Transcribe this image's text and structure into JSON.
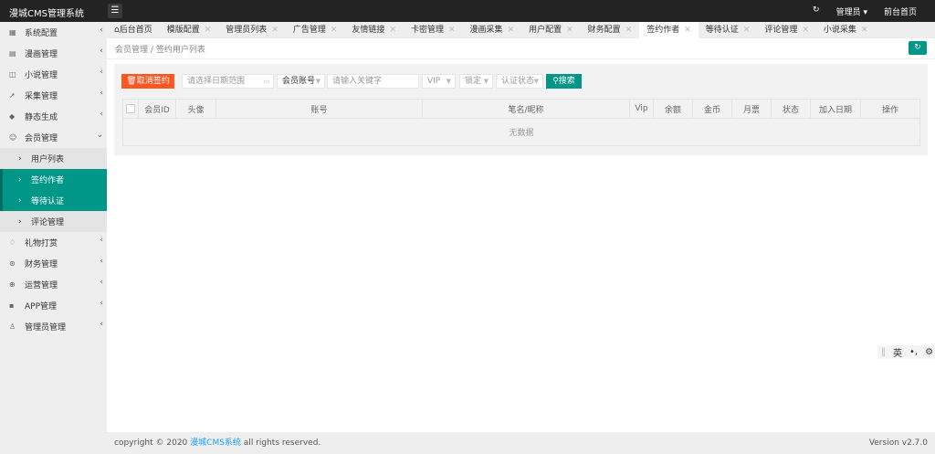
{
  "header": {
    "title": "漫城CMS管理系统",
    "menu_icon": "menu-icon",
    "refresh_icon": "refresh-icon",
    "user": "管理员",
    "home": "前台首页"
  },
  "sidebar": {
    "items": [
      {
        "icon": "sitemap-icon",
        "label": "系统配置"
      },
      {
        "icon": "comic-icon",
        "label": "漫画管理"
      },
      {
        "icon": "book-icon",
        "label": "小说管理"
      },
      {
        "icon": "paper-plane-icon",
        "label": "采集管理"
      },
      {
        "icon": "graduation-icon",
        "label": "静态生成"
      },
      {
        "icon": "user-icon",
        "label": "会员管理",
        "expanded": true,
        "children": [
          {
            "label": "用户列表"
          },
          {
            "label": "签约作者",
            "active": true
          },
          {
            "label": "等待认证",
            "active": true
          },
          {
            "label": "评论管理"
          }
        ]
      },
      {
        "icon": "gift-icon",
        "label": "礼物打赏"
      },
      {
        "icon": "finance-icon",
        "label": "财务管理"
      },
      {
        "icon": "globe-icon",
        "label": "运营管理"
      },
      {
        "icon": "windows-icon",
        "label": "APP管理"
      },
      {
        "icon": "admin-icon",
        "label": "管理员管理"
      }
    ]
  },
  "tabs": [
    {
      "label": "后台首页"
    },
    {
      "label": "模版配置"
    },
    {
      "label": "管理员列表"
    },
    {
      "label": "广告管理"
    },
    {
      "label": "友情链接"
    },
    {
      "label": "卡密管理"
    },
    {
      "label": "漫画采集"
    },
    {
      "label": "用户配置"
    },
    {
      "label": "财务配置"
    },
    {
      "label": "签约作者",
      "active": true
    },
    {
      "label": "等待认证"
    },
    {
      "label": "评论管理"
    },
    {
      "label": "小说采集"
    }
  ],
  "breadcrumb": {
    "parent": "会员管理",
    "sep": "/",
    "current": "签约用户列表"
  },
  "toolbar": {
    "cancel_sign": "取消签约",
    "date_placeholder": "请选择日期范围",
    "field_select": "会员账号",
    "keyword_placeholder": "请输入关键字",
    "vip_select": "VIP",
    "lock_select": "锁定",
    "auth_select": "认证状态",
    "search": "搜索"
  },
  "table": {
    "columns": [
      "会员ID",
      "头像",
      "账号",
      "笔名/昵称",
      "Vip",
      "余额",
      "金币",
      "月票",
      "状态",
      "加入日期",
      "操作"
    ],
    "empty": "无数据"
  },
  "ime": {
    "lang": "英",
    "punct": "•,"
  },
  "footer": {
    "copyright": "copyright © 2020",
    "link": "漫城CMS系统",
    "rights": "all rights reserved.",
    "version": "Version v2.7.0"
  },
  "colors": {
    "accent": "#009688",
    "danger": "#ff5722",
    "topbar": "#232323"
  }
}
